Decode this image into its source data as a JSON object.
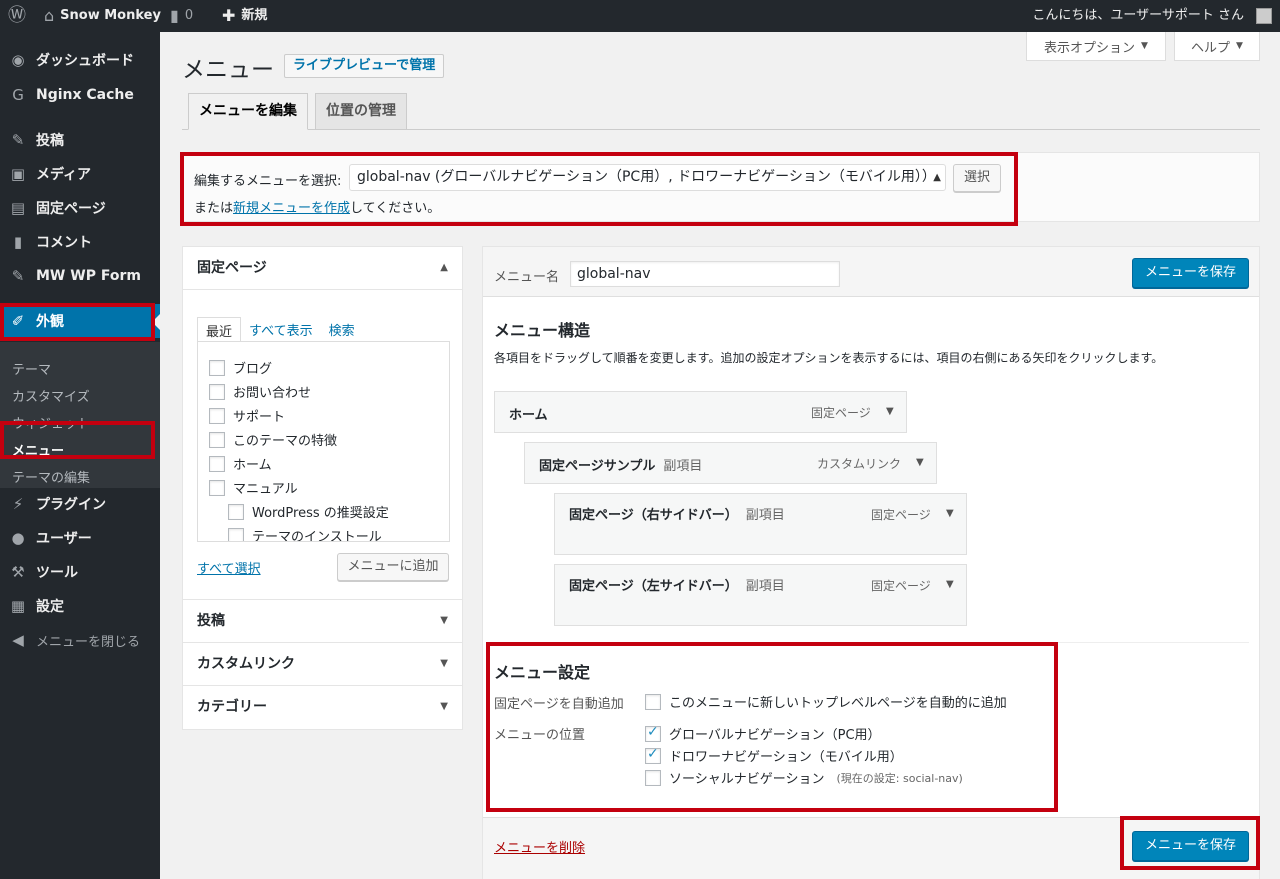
{
  "adminbar": {
    "site_name": "Snow Monkey",
    "comments_count": "0",
    "new_label": "新規",
    "greeting": "こんにちは、ユーザーサポート さん"
  },
  "sidebar": {
    "items": [
      {
        "label": "ダッシュボード",
        "icon": "dashboard-icon"
      },
      {
        "label": "Nginx Cache",
        "icon": "nginx-icon"
      },
      {
        "label": "投稿",
        "icon": "pin-icon"
      },
      {
        "label": "メディア",
        "icon": "media-icon"
      },
      {
        "label": "固定ページ",
        "icon": "page-icon"
      },
      {
        "label": "コメント",
        "icon": "comment-icon"
      },
      {
        "label": "MW WP Form",
        "icon": "pin-icon"
      },
      {
        "label": "外観",
        "icon": "brush-icon"
      },
      {
        "label": "プラグイン",
        "icon": "plugin-icon"
      },
      {
        "label": "ユーザー",
        "icon": "user-icon"
      },
      {
        "label": "ツール",
        "icon": "wrench-icon"
      },
      {
        "label": "設定",
        "icon": "settings-icon"
      },
      {
        "label": "メニューを閉じる",
        "icon": "collapse-icon"
      }
    ],
    "submenu": [
      "テーマ",
      "カスタマイズ",
      "ウィジェット",
      "メニュー",
      "テーマの編集"
    ]
  },
  "screen_options": "表示オプション",
  "help": "ヘルプ",
  "page_title": "メニュー",
  "live_preview": "ライブプレビューで管理",
  "tabs": [
    "メニューを編集",
    "位置の管理"
  ],
  "select_menu": {
    "label": "編集するメニューを選択:",
    "value": "global-nav (グローバルナビゲーション（PC用）, ドロワーナビゲーション（モバイル用））",
    "button": "選択",
    "note_prefix": "または",
    "note_link": "新規メニューを作成",
    "note_suffix": "してください。"
  },
  "left_panel": {
    "pages_title": "固定ページ",
    "tabs": [
      "最近",
      "すべて表示",
      "検索"
    ],
    "pages": [
      "ブログ",
      "お問い合わせ",
      "サポート",
      "このテーマの特徴",
      "ホーム",
      "マニュアル"
    ],
    "child_pages": [
      "WordPress の推奨設定",
      "テーマのインストール"
    ],
    "select_all": "すべて選択",
    "add_button": "メニューに追加",
    "sections": [
      "投稿",
      "カスタムリンク",
      "カテゴリー"
    ]
  },
  "menu_editor": {
    "name_label": "メニュー名",
    "name_value": "global-nav",
    "save_label": "メニューを保存",
    "structure_title": "メニュー構造",
    "structure_desc": "各項目をドラッグして順番を変更します。追加の設定オプションを表示するには、項目の右側にある矢印をクリックします。",
    "items": [
      {
        "title": "ホーム",
        "sub": "",
        "type": "固定ページ"
      },
      {
        "title": "固定ページサンプル",
        "sub": "副項目",
        "type": "カスタムリンク"
      },
      {
        "title": "固定ページ（右サイドバー）",
        "sub": "副項目",
        "type": "固定ページ"
      },
      {
        "title": "固定ページ（左サイドバー）",
        "sub": "副項目",
        "type": "固定ページ"
      }
    ],
    "settings_title": "メニュー設定",
    "auto_add_label": "固定ページを自動追加",
    "auto_add_text": "このメニューに新しいトップレベルページを自動的に追加",
    "location_label": "メニューの位置",
    "locations": [
      {
        "label": "グローバルナビゲーション（PC用）",
        "checked": true,
        "note": ""
      },
      {
        "label": "ドロワーナビゲーション（モバイル用）",
        "checked": true,
        "note": ""
      },
      {
        "label": "ソーシャルナビゲーション",
        "checked": false,
        "note": "(現在の設定: social-nav)"
      }
    ],
    "delete_label": "メニューを削除"
  }
}
